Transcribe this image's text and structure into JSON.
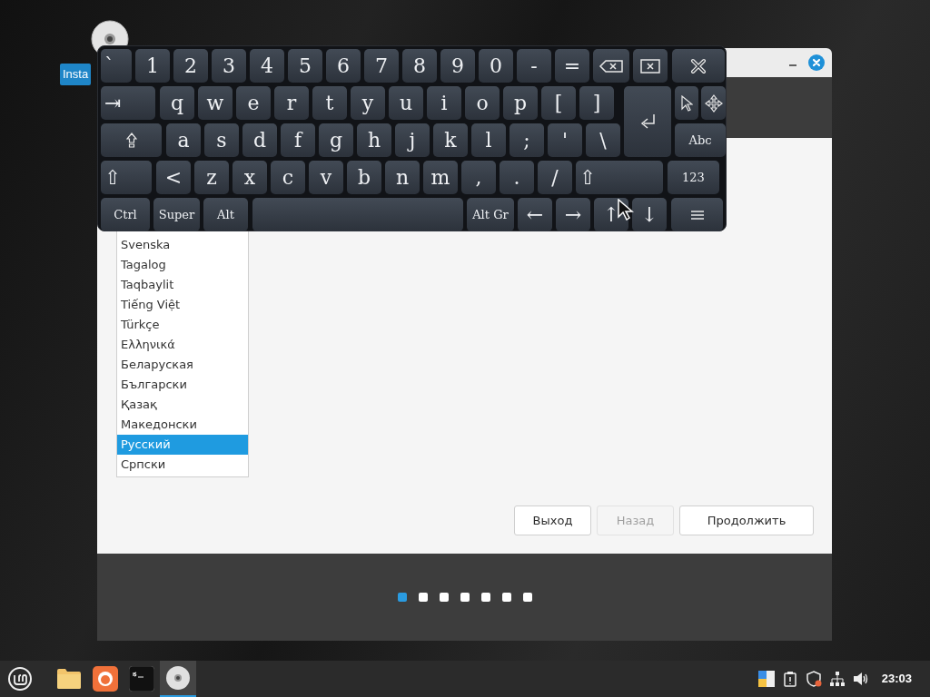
{
  "desktop_icon": {
    "label": "Insta"
  },
  "window": {
    "controls": [
      {
        "kind": "minimize"
      },
      {
        "kind": "close"
      }
    ]
  },
  "language_list": {
    "items": [
      {
        "label": "Svenska",
        "selected": false
      },
      {
        "label": "Tagalog",
        "selected": false
      },
      {
        "label": "Taqbaylit",
        "selected": false
      },
      {
        "label": "Tiếng Việt",
        "selected": false
      },
      {
        "label": "Türkçe",
        "selected": false
      },
      {
        "label": "Ελληνικά",
        "selected": false
      },
      {
        "label": "Беларуская",
        "selected": false
      },
      {
        "label": "Български",
        "selected": false
      },
      {
        "label": "Қазақ",
        "selected": false
      },
      {
        "label": "Македонски",
        "selected": false
      },
      {
        "label": "Русский",
        "selected": true
      },
      {
        "label": "Српски",
        "selected": false
      }
    ]
  },
  "buttons": [
    {
      "label": "Выход",
      "disabled": false
    },
    {
      "label": "Назад",
      "disabled": true
    },
    {
      "label": "Продолжить",
      "disabled": false
    }
  ],
  "progress_dots": [
    {
      "selected": true
    },
    {
      "selected": false
    },
    {
      "selected": false
    },
    {
      "selected": false
    },
    {
      "selected": false
    },
    {
      "selected": false
    },
    {
      "selected": false
    }
  ],
  "keyboard": {
    "keys": [
      {
        "kind": "text",
        "label": "`"
      },
      {
        "kind": "text",
        "label": "1"
      },
      {
        "kind": "text",
        "label": "2"
      },
      {
        "kind": "text",
        "label": "3"
      },
      {
        "kind": "text",
        "label": "4"
      },
      {
        "kind": "text",
        "label": "5"
      },
      {
        "kind": "text",
        "label": "6"
      },
      {
        "kind": "text",
        "label": "7"
      },
      {
        "kind": "text",
        "label": "8"
      },
      {
        "kind": "text",
        "label": "9"
      },
      {
        "kind": "text",
        "label": "0"
      },
      {
        "kind": "text",
        "label": "-"
      },
      {
        "kind": "text",
        "label": "="
      },
      {
        "kind": "backspace"
      },
      {
        "kind": "clear"
      },
      {
        "kind": "close"
      },
      {
        "kind": "text",
        "label": "⇥"
      },
      {
        "kind": "text",
        "label": "q"
      },
      {
        "kind": "text",
        "label": "w"
      },
      {
        "kind": "text",
        "label": "e"
      },
      {
        "kind": "text",
        "label": "r"
      },
      {
        "kind": "text",
        "label": "t"
      },
      {
        "kind": "text",
        "label": "y"
      },
      {
        "kind": "text",
        "label": "u"
      },
      {
        "kind": "text",
        "label": "i"
      },
      {
        "kind": "text",
        "label": "o"
      },
      {
        "kind": "text",
        "label": "p"
      },
      {
        "kind": "text",
        "label": "["
      },
      {
        "kind": "text",
        "label": "]"
      },
      {
        "kind": "enter"
      },
      {
        "kind": "pointer"
      },
      {
        "kind": "move"
      },
      {
        "kind": "caps"
      },
      {
        "kind": "text",
        "label": "a"
      },
      {
        "kind": "text",
        "label": "s"
      },
      {
        "kind": "text",
        "label": "d"
      },
      {
        "kind": "text",
        "label": "f"
      },
      {
        "kind": "text",
        "label": "g"
      },
      {
        "kind": "text",
        "label": "h"
      },
      {
        "kind": "text",
        "label": "j"
      },
      {
        "kind": "text",
        "label": "k"
      },
      {
        "kind": "text",
        "label": "l"
      },
      {
        "kind": "text",
        "label": ";"
      },
      {
        "kind": "text",
        "label": "'"
      },
      {
        "kind": "text",
        "label": "\\"
      },
      {
        "kind": "text",
        "label": "Abc"
      },
      {
        "kind": "text",
        "label": "⇧"
      },
      {
        "kind": "text",
        "label": "<"
      },
      {
        "kind": "text",
        "label": "z"
      },
      {
        "kind": "text",
        "label": "x"
      },
      {
        "kind": "text",
        "label": "c"
      },
      {
        "kind": "text",
        "label": "v"
      },
      {
        "kind": "text",
        "label": "b"
      },
      {
        "kind": "text",
        "label": "n"
      },
      {
        "kind": "text",
        "label": "m"
      },
      {
        "kind": "text",
        "label": ","
      },
      {
        "kind": "text",
        "label": "."
      },
      {
        "kind": "text",
        "label": "/"
      },
      {
        "kind": "text",
        "label": "⇧"
      },
      {
        "kind": "text",
        "label": "123"
      },
      {
        "kind": "text",
        "label": "Ctrl"
      },
      {
        "kind": "text",
        "label": "Super"
      },
      {
        "kind": "text",
        "label": "Alt"
      },
      {
        "kind": "space"
      },
      {
        "kind": "text",
        "label": "Alt Gr"
      },
      {
        "kind": "text",
        "label": "←"
      },
      {
        "kind": "text",
        "label": "→"
      },
      {
        "kind": "text",
        "label": "↑"
      },
      {
        "kind": "text",
        "label": "↓"
      },
      {
        "kind": "menu"
      }
    ]
  },
  "taskbar": {
    "apps": [
      {
        "kind": "menu",
        "active": false
      },
      {
        "kind": "files",
        "active": false
      },
      {
        "kind": "browser",
        "active": false
      },
      {
        "kind": "terminal",
        "active": false
      },
      {
        "kind": "disc",
        "active": true
      }
    ],
    "tray": [
      {
        "kind": "colors"
      },
      {
        "kind": "clipboard"
      },
      {
        "kind": "shield"
      },
      {
        "kind": "network"
      },
      {
        "kind": "volume"
      }
    ],
    "clock": "23:03"
  }
}
